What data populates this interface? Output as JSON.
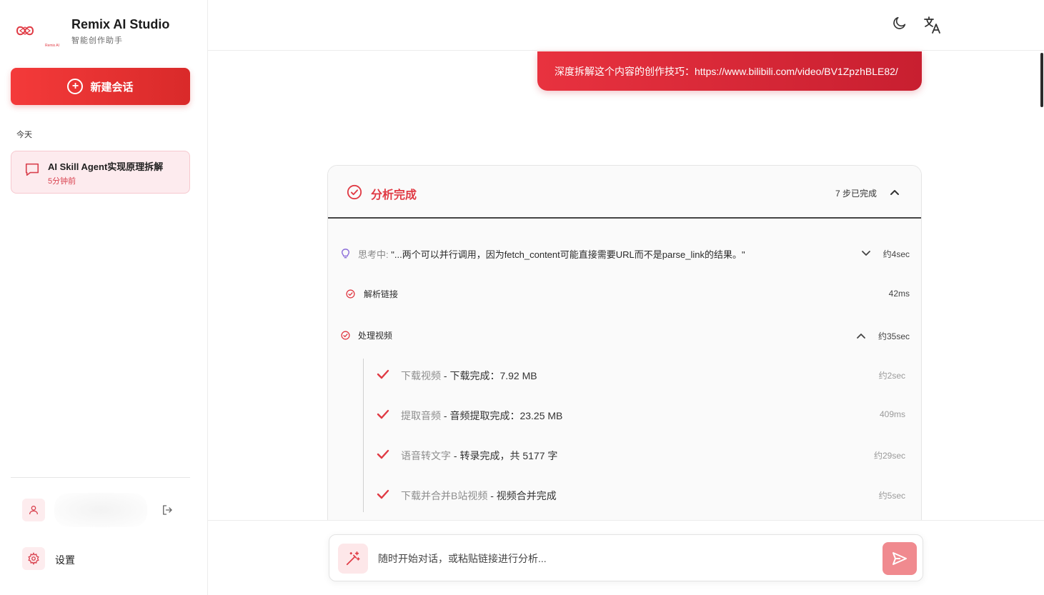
{
  "sidebar": {
    "brand_title": "Remix AI Studio",
    "brand_subtitle": "智能创作助手",
    "logo_text": "Remix AI",
    "new_chat_label": "新建会话",
    "section_today": "今天",
    "chats": [
      {
        "title": "AI Skill Agent实现原理拆解",
        "time": "5分钟前"
      }
    ],
    "settings_label": "设置"
  },
  "header": {
    "theme_icon": "moon-icon",
    "language_icon": "translate-icon"
  },
  "conversation": {
    "user_message": "深度拆解这个内容的创作技巧：https://www.bilibili.com/video/BV1ZpzhBLE82/",
    "analysis": {
      "title": "分析完成",
      "steps_done": "7 步已完成",
      "steps": [
        {
          "label": "思考中:",
          "text": "\"...两个可以并行调用，因为fetch_content可能直接需要URL而不是parse_link的结果。\"",
          "time": "约4sec"
        },
        {
          "label": "解析链接",
          "time": "42ms"
        },
        {
          "label": "处理视频",
          "time": "约35sec"
        }
      ],
      "substeps": [
        {
          "name": "下载视频",
          "result": " - 下载完成：7.92 MB",
          "time": "约2sec"
        },
        {
          "name": "提取音频",
          "result": " - 音频提取完成：23.25 MB",
          "time": "409ms"
        },
        {
          "name": "语音转文字",
          "result": " - 转录完成，共 5177 字",
          "time": "约29sec"
        },
        {
          "name": "下载并合并B站视频",
          "result": " - 视频合并完成",
          "time": "约5sec"
        }
      ]
    }
  },
  "composer": {
    "placeholder": "随时开始对话，或粘贴链接进行分析...",
    "value": ""
  },
  "colors": {
    "accent": "#e03a44",
    "accent_dark": "#c81f30",
    "accent_soft": "#fdebee"
  }
}
